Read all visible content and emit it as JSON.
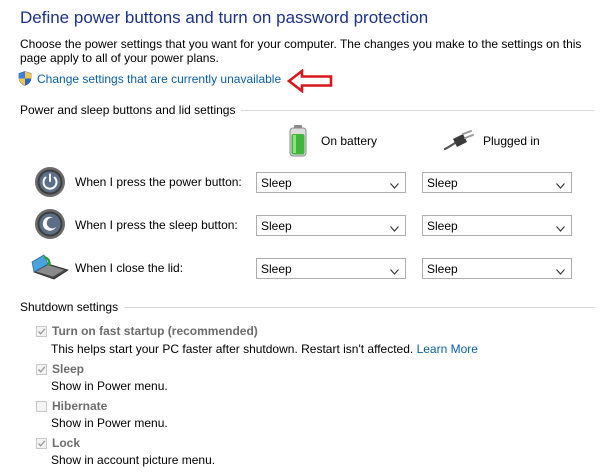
{
  "page": {
    "title": "Define power buttons and turn on password protection",
    "description": "Choose the power settings that you want for your computer. The changes you make to the settings on this page apply to all of your power plans.",
    "change_link": "Change settings that are currently unavailable"
  },
  "power_section": {
    "header": "Power and sleep buttons and lid settings",
    "columns": [
      {
        "label": "On battery",
        "icon": "battery-icon"
      },
      {
        "label": "Plugged in",
        "icon": "plug-icon"
      }
    ],
    "rows": [
      {
        "label": "When I press the power button:",
        "icon": "power-button-icon",
        "on_battery": "Sleep",
        "plugged_in": "Sleep"
      },
      {
        "label": "When I press the sleep button:",
        "icon": "sleep-button-icon",
        "on_battery": "Sleep",
        "plugged_in": "Sleep"
      },
      {
        "label": "When I close the lid:",
        "icon": "laptop-lid-icon",
        "on_battery": "Sleep",
        "plugged_in": "Sleep"
      }
    ]
  },
  "shutdown_section": {
    "header": "Shutdown settings",
    "items": [
      {
        "label": "Turn on fast startup (recommended)",
        "checked": true,
        "description": "This helps start your PC faster after shutdown. Restart isn't affected.",
        "link": "Learn More"
      },
      {
        "label": "Sleep",
        "checked": true,
        "description": "Show in Power menu."
      },
      {
        "label": "Hibernate",
        "checked": false,
        "description": "Show in Power menu."
      },
      {
        "label": "Lock",
        "checked": true,
        "description": "Show in account picture menu."
      }
    ]
  },
  "colors": {
    "title": "#1e3287",
    "link": "#0a5fa8",
    "annotation_arrow": "#d9161c",
    "disabled_text": "#6d6d6d"
  }
}
